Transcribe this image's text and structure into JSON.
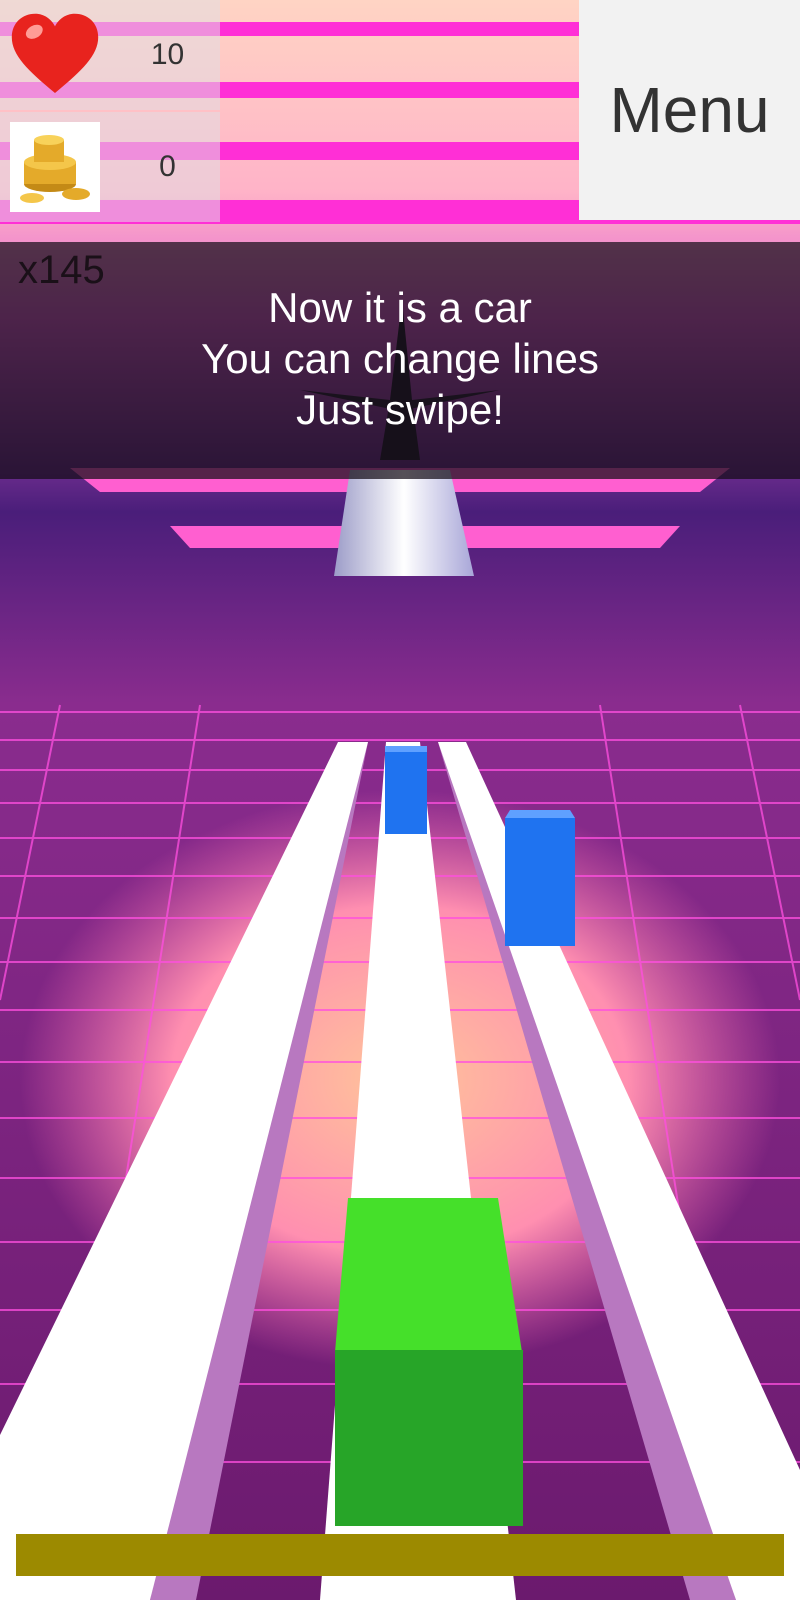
{
  "hud": {
    "lives": {
      "icon": "heart-icon",
      "value": "10"
    },
    "coins": {
      "icon": "coin-stack-icon",
      "value": "0"
    },
    "menu_label": "Menu"
  },
  "score": {
    "multiplier": "x145"
  },
  "tutorial": {
    "lines": [
      "Now it is a car",
      "You can change lines",
      "Just swipe!"
    ]
  },
  "progress": {
    "fraction": 1.0
  },
  "colors": {
    "player": "#3fd62a",
    "obstacle": "#1f73f0",
    "track": "#ffffff",
    "progress": "#9c8a00",
    "neon": "#ff2fd6"
  }
}
